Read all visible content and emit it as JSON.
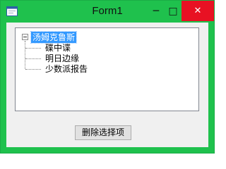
{
  "window": {
    "title": "Form1",
    "minimize_glyph": "─",
    "maximize_glyph": "□",
    "close_glyph": "✕"
  },
  "tree": {
    "root": {
      "label": "汤姆克鲁斯",
      "selected": true,
      "expanded": true
    },
    "children": [
      {
        "label": "碟中谍"
      },
      {
        "label": "明日边缘"
      },
      {
        "label": "少数派报告"
      }
    ]
  },
  "actions": {
    "delete_label": "删除选择项"
  },
  "colors": {
    "titlebar": "#1fc14d",
    "close_button": "#e81123",
    "selection": "#3399ff"
  }
}
